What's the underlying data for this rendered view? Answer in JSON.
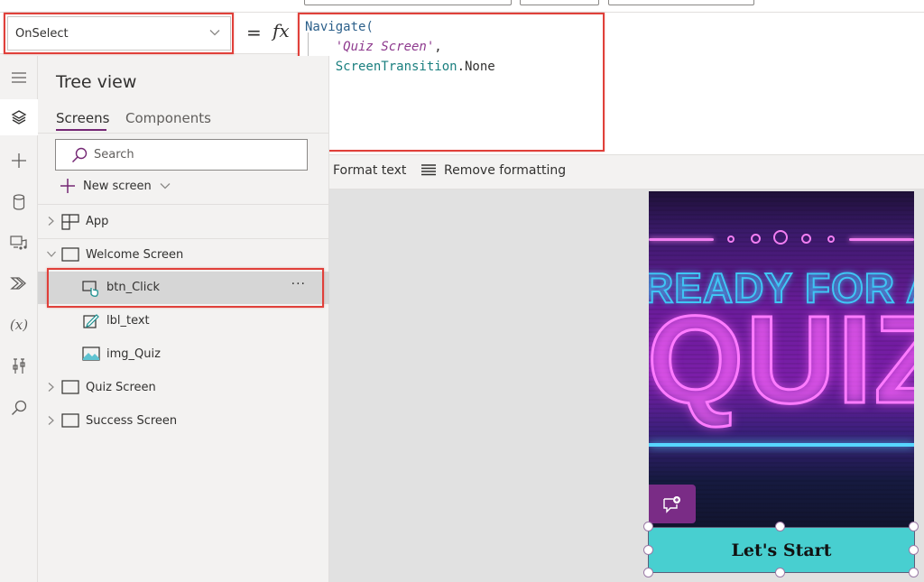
{
  "formula_bar": {
    "property": "OnSelect",
    "equals": "=",
    "fx": "fx",
    "code": {
      "fn": "Navigate(",
      "arg1": "'Quiz Screen'",
      "comma": ",",
      "arg2_enum": "ScreenTransition",
      "arg2_member": ".None",
      "close": ")"
    }
  },
  "format_toolbar": {
    "format_text": "Format text",
    "remove_formatting": "Remove formatting"
  },
  "left_rail": {
    "items": [
      {
        "icon": "hamburger-menu-icon"
      },
      {
        "icon": "layers-icon",
        "active": true
      },
      {
        "icon": "plus-icon"
      },
      {
        "icon": "database-icon"
      },
      {
        "icon": "media-icon"
      },
      {
        "icon": "power-automate-icon"
      },
      {
        "icon": "variables-icon",
        "glyph": "(x)"
      },
      {
        "icon": "tools-icon"
      },
      {
        "icon": "search-icon"
      }
    ]
  },
  "tree_view": {
    "title": "Tree view",
    "tabs": [
      {
        "label": "Screens",
        "active": true
      },
      {
        "label": "Components",
        "active": false
      }
    ],
    "search_placeholder": "Search",
    "new_screen": "New screen",
    "nodes": [
      {
        "label": "App",
        "type": "app",
        "expanded": false
      },
      {
        "label": "Welcome Screen",
        "type": "screen",
        "expanded": true
      },
      {
        "label": "btn_Click",
        "type": "button",
        "selected": true,
        "more": "···"
      },
      {
        "label": "lbl_text",
        "type": "label"
      },
      {
        "label": "img_Quiz",
        "type": "image"
      },
      {
        "label": "Quiz Screen",
        "type": "screen",
        "expanded": false
      },
      {
        "label": "Success Screen",
        "type": "screen",
        "expanded": false
      }
    ]
  },
  "canvas": {
    "image_text_line1": "READY FOR A",
    "image_text_line2": "QUIZ?",
    "button_label": "Let's Start",
    "colors": {
      "button_fill": "#48cfd0",
      "accent": "#742774",
      "highlight_box": "#e0403a"
    }
  }
}
